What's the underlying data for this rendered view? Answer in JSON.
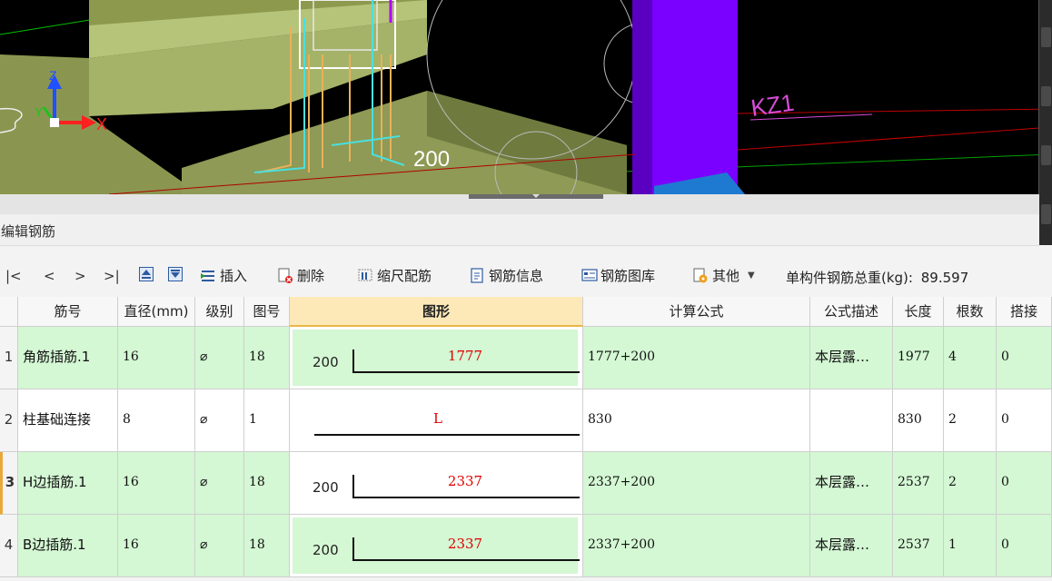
{
  "viewport": {
    "dimension_label": "200",
    "column_label": "KZ1",
    "axis_x": "X",
    "axis_y": "Y",
    "axis_z": "Z"
  },
  "panel": {
    "title": "编辑钢筋"
  },
  "toolbar": {
    "nav_first": "|<",
    "nav_prev": "<",
    "nav_next": ">",
    "nav_last": ">|",
    "insert": "插入",
    "delete": "删除",
    "scale_rebar": "缩尺配筋",
    "rebar_info": "钢筋信息",
    "rebar_library": "钢筋图库",
    "other": "其他",
    "total_label": "单构件钢筋总重(kg):",
    "total_value": "89.597"
  },
  "table": {
    "columns": [
      "筋号",
      "直径(mm)",
      "级别",
      "图号",
      "图形",
      "计算公式",
      "公式描述",
      "长度",
      "根数",
      "搭接"
    ],
    "rows": [
      {
        "n": "1",
        "name": "角筋插筋.1",
        "dia": "16",
        "grade": "⌀",
        "fig": "18",
        "shape_left": "200",
        "shape_top": "1777",
        "formula": "1777+200",
        "desc": "本层露…",
        "len": "1977",
        "count": "4",
        "lap": "0",
        "hook": true
      },
      {
        "n": "2",
        "name": "柱基础连接",
        "dia": "8",
        "grade": "⌀",
        "fig": "1",
        "shape_left": "",
        "shape_top": "L",
        "formula": "830",
        "desc": "",
        "len": "830",
        "count": "2",
        "lap": "0",
        "hook": false
      },
      {
        "n": "3",
        "name": "H边插筋.1",
        "dia": "16",
        "grade": "⌀",
        "fig": "18",
        "shape_left": "200",
        "shape_top": "2337",
        "formula": "2337+200",
        "desc": "本层露…",
        "len": "2537",
        "count": "2",
        "lap": "0",
        "hook": true
      },
      {
        "n": "4",
        "name": "B边插筋.1",
        "dia": "16",
        "grade": "⌀",
        "fig": "18",
        "shape_left": "200",
        "shape_top": "2337",
        "formula": "2337+200",
        "desc": "本层露…",
        "len": "2537",
        "count": "1",
        "lap": "0",
        "hook": true
      }
    ]
  },
  "colors": {
    "row_green": "#d4f7d4",
    "header_active": "#fde9b8",
    "column_purple": "#7a00ff",
    "shape_red": "#e00000"
  }
}
